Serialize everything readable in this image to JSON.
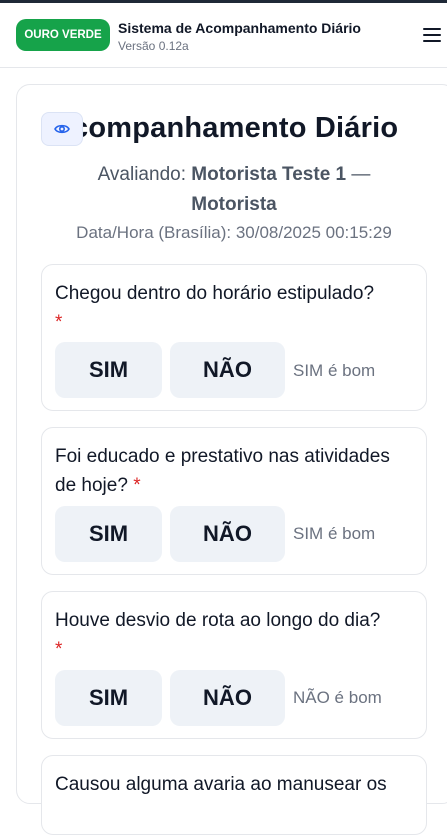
{
  "header": {
    "brand": "OURO VERDE",
    "title": "Sistema de Acompanhamento Diário",
    "version": "Versão 0.12a"
  },
  "page": {
    "title": "companhamento Diário",
    "evaluating_label": "Avaliando:",
    "evaluating_name": "Motorista Teste 1",
    "evaluating_separator": "—",
    "evaluating_role": "Motorista",
    "datetime": "Data/Hora (Brasília): 30/08/2025 00:15:29"
  },
  "questions": [
    {
      "text": "Chegou dentro do horário estipulado?",
      "required": "*",
      "yes": "SIM",
      "no": "NÃO",
      "hint": "SIM é bom"
    },
    {
      "text": "Foi educado e prestativo nas atividades de hoje?",
      "required": "*",
      "yes": "SIM",
      "no": "NÃO",
      "hint": "SIM é bom"
    },
    {
      "text": "Houve desvio de rota ao longo do dia?",
      "required": "*",
      "yes": "SIM",
      "no": "NÃO",
      "hint": "NÃO é bom"
    },
    {
      "text": "Causou alguma avaria ao manusear os"
    }
  ],
  "colors": {
    "brand": "#16a34a",
    "required": "#dc2626",
    "button_bg": "#eef2f7"
  },
  "icons": {
    "menu": "hamburger-icon",
    "view": "eye-icon"
  }
}
